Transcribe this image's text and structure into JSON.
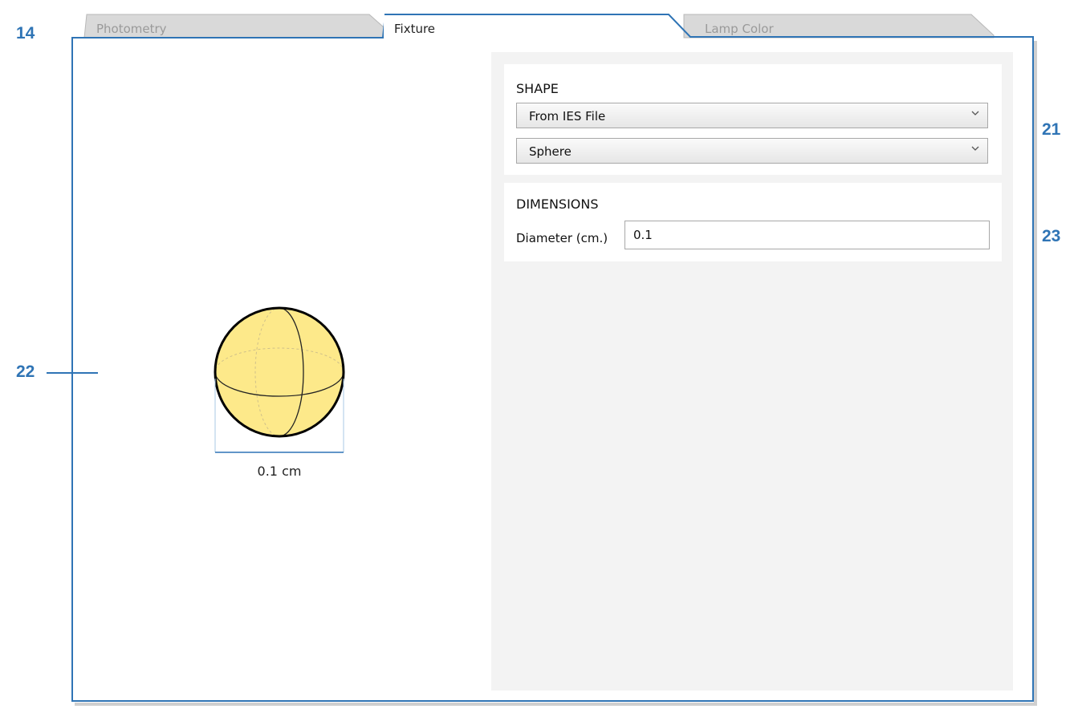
{
  "callouts": {
    "c14": "14",
    "c21": "21",
    "c22": "22",
    "c23": "23"
  },
  "tabs": [
    {
      "label": "Photometry",
      "active": false
    },
    {
      "label": "Fixture",
      "active": true
    },
    {
      "label": "Lamp Color",
      "active": false
    }
  ],
  "preview": {
    "dimension_label": "0.1 cm",
    "sphere_color": "#fde98a"
  },
  "shape": {
    "title": "SHAPE",
    "source_value": "From IES File",
    "shape_value": "Sphere"
  },
  "dimensions": {
    "title": "DIMENSIONS",
    "diameter_label": "Diameter (cm.)",
    "diameter_value": "0.1"
  },
  "colors": {
    "accent": "#2f74b5",
    "tab_inactive": "#d9d9d9",
    "panel": "#f3f3f3"
  }
}
